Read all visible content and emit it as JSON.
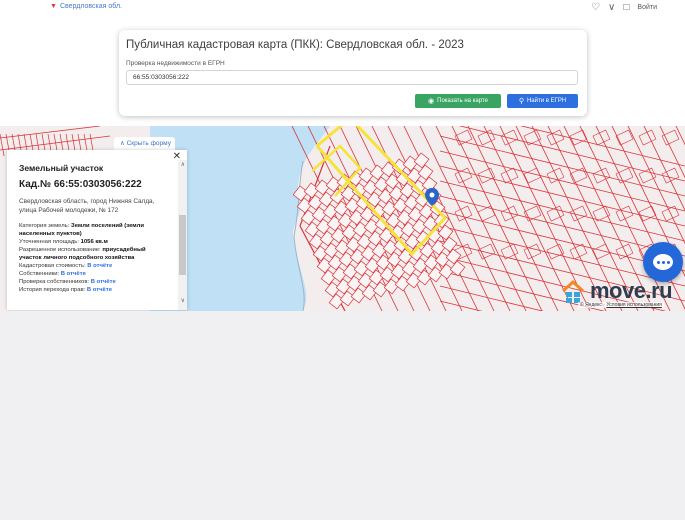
{
  "topbar": {
    "region": "Свердловская обл.",
    "login": "Войти"
  },
  "search": {
    "title": "Публичная кадастровая карта (ПКК): Свердловская обл. - 2023",
    "label": "Проверка недвижимости в ЕГРН",
    "value": "66:55:0303056:222",
    "show_button": "Показать на карте",
    "find_button": "Найти в ЕГРН"
  },
  "panel": {
    "hide_form": "Скрыть форму",
    "heading": "Земельный участок",
    "cadastral": "Кад.№ 66:55:0303056:222",
    "address": "Свердловская область, город Нижняя Салда, улица Рабочей молодежи, № 172",
    "category_label": "Категория земель:",
    "category_value": "Земли поселений (земли населенных пунктов)",
    "area_label": "Уточненная площадь:",
    "area_value": "1056 кв.м",
    "use_label": "Разрешенное использование:",
    "use_value": "приусадебный участок личного подсобного хозяйства",
    "cost_label": "Кадастровая стоимость:",
    "owners_label": "Собственники:",
    "check_label": "Проверка собственников:",
    "history_label": "История перехода прав:",
    "in_report": "В отчёте"
  },
  "map": {
    "brand": "move.ru",
    "copyright_prefix": "© Яндекс",
    "copyright_link": "Условия использования",
    "colors": {
      "water": "#bfe0f5",
      "parcel_line": "#d9343b",
      "highlight": "#f5e33a",
      "marker": "#2a66c8"
    }
  }
}
